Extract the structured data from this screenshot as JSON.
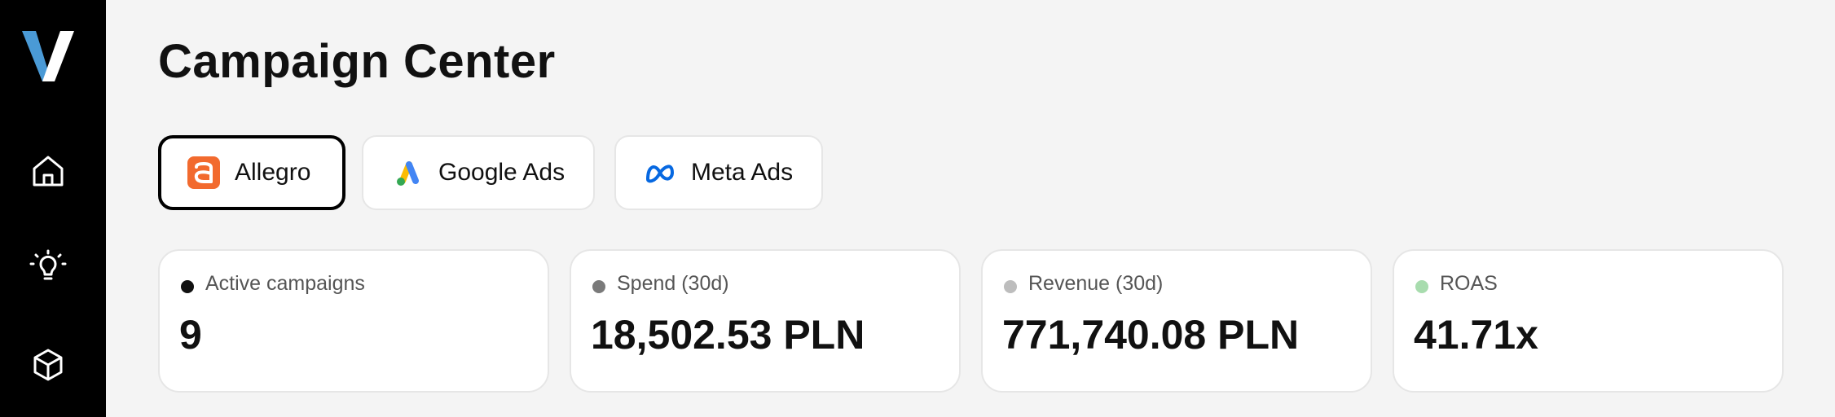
{
  "app": {
    "logo_icon": "v-logo-icon",
    "accent_blue": "#4a9ad6"
  },
  "sidebar": {
    "items": [
      {
        "icon": "home-icon"
      },
      {
        "icon": "lightbulb-icon"
      },
      {
        "icon": "cube-icon"
      }
    ]
  },
  "header": {
    "title": "Campaign Center"
  },
  "tabs": [
    {
      "label": "Allegro",
      "icon": "allegro-icon",
      "active": true,
      "color": "#ff5a00"
    },
    {
      "label": "Google Ads",
      "icon": "google-ads-icon",
      "active": false
    },
    {
      "label": "Meta Ads",
      "icon": "meta-icon",
      "active": false,
      "color": "#0668e1"
    }
  ],
  "kpis": [
    {
      "label": "Active campaigns",
      "value": "9",
      "dot_color": "#111111"
    },
    {
      "label": "Spend (30d)",
      "value": "18,502.53 PLN",
      "dot_color": "#7a7a7a"
    },
    {
      "label": "Revenue (30d)",
      "value": "771,740.08 PLN",
      "dot_color": "#bdbdbd"
    },
    {
      "label": "ROAS",
      "value": "41.71x",
      "dot_color": "#a8dcae"
    }
  ]
}
